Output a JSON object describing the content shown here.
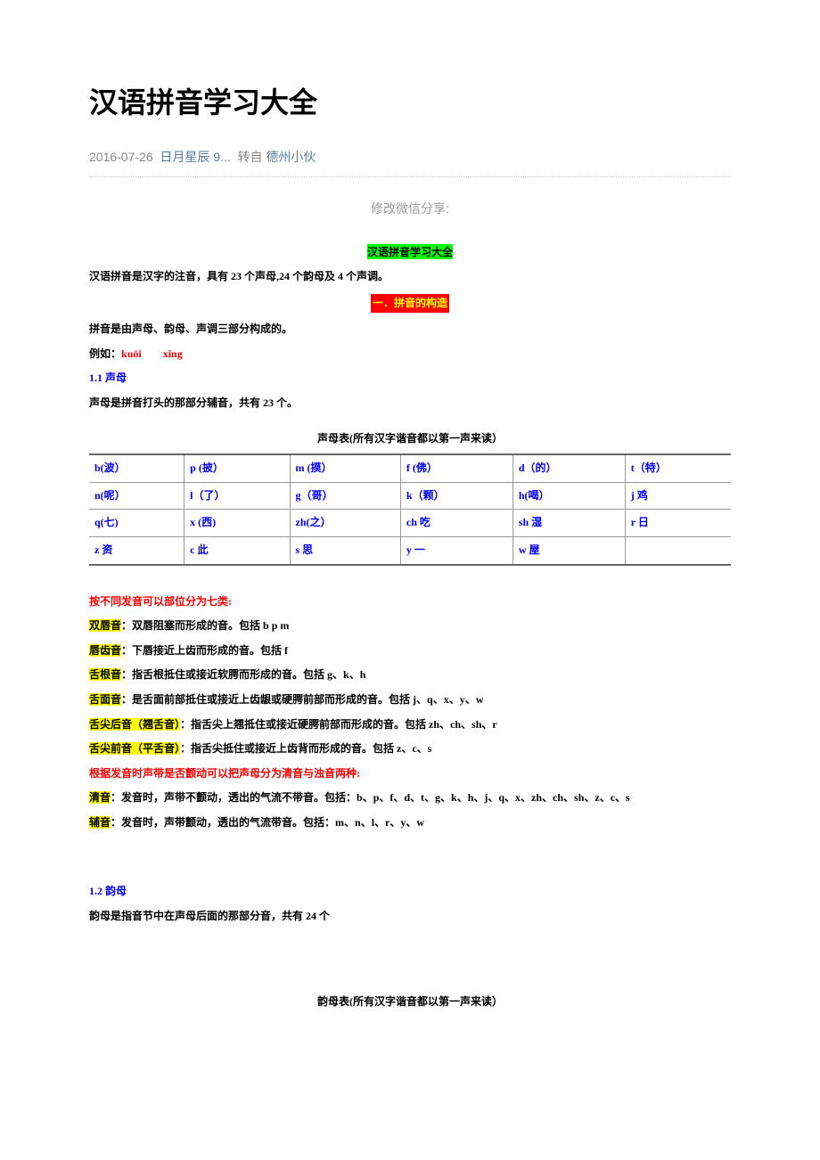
{
  "page_title": "汉语拼音学习大全",
  "meta": {
    "date": "2016-07-26",
    "author": "日月星辰 9...",
    "repost_label": "转自",
    "source": "德州小伙"
  },
  "share_label": "修改微信分享:",
  "doc_title": "汉语拼音学习大全",
  "intro": "汉语拼音是汉字的注音，具有 23 个声母,24 个韵母及 4 个声调。",
  "section1_banner": "一．拼音的构造",
  "section1_intro": "拼音是由声母、韵母、声调三部分构成的。",
  "example_prefix": "例如：",
  "example_pinyin": "kuōi　　xǐng",
  "s11_header": "1.1 声母",
  "s11_body": "声母是拼音打头的那部分辅音，共有 23 个。",
  "shengmu_caption": "声母表(所有汉字谐音都以第一声来读）",
  "shengmu_rows": [
    [
      "b(波）",
      "p (披）",
      "m (摸）",
      "f (佛）",
      "d（的）",
      "t（特）"
    ],
    [
      "n(呢）",
      "l（了）",
      "g（哥）",
      "k（颗）",
      "h(喝）",
      "j 鸡"
    ],
    [
      "q(七)",
      "x (西)",
      "zh(之）",
      "ch 吃",
      "sh 湿",
      "r 日"
    ],
    [
      "z 资",
      "c 此",
      "s 思",
      "y 一",
      "w 屋",
      ""
    ]
  ],
  "cat_header": "按不同发音可以部位分为七类:",
  "cats": [
    {
      "label": "双唇音",
      "text": "：双唇阻塞而形成的音。包括 b p m"
    },
    {
      "label": "唇齿音",
      "text": "：下唇接近上齿而形成的音。包括 f"
    },
    {
      "label": "舌根音",
      "text": "：指舌根抵住或接近软腭而形成的音。包括 g、k、h"
    },
    {
      "label": "舌面音",
      "text": "：是舌面前部抵住或接近上齿龈或硬腭前部而形成的音。包括 j、q、x、y、w"
    },
    {
      "label": "舌尖后音（翘舌音）",
      "text": "：指舌尖上翘抵住或接近硬腭前部而形成的音。包括 zh、ch、sh、r"
    },
    {
      "label": "舌尖前音（平舌音）",
      "text": "：指舌尖抵住或接近上齿背而形成的音。包括 z、c、s"
    }
  ],
  "voice_header": "根据发音时声带是否颤动可以把声母分为清音与浊音两种:",
  "voices": [
    {
      "label": "清音",
      "text": "：发音时，声带不颤动，透出的气流不带音。包括：b、p、f、d、t、g、k、h、j、q、x、zh、ch、sh、z、c、s"
    },
    {
      "label": "辅音",
      "text": "：发音时，声带颤动，透出的气流带音。包括：m、n、l、r、y、w"
    }
  ],
  "s12_header": "1.2 韵母",
  "s12_body": "韵母是指音节中在声母后面的那部分音，共有 24 个",
  "yunmu_caption": "韵母表(所有汉字谐音都以第一声来读）"
}
